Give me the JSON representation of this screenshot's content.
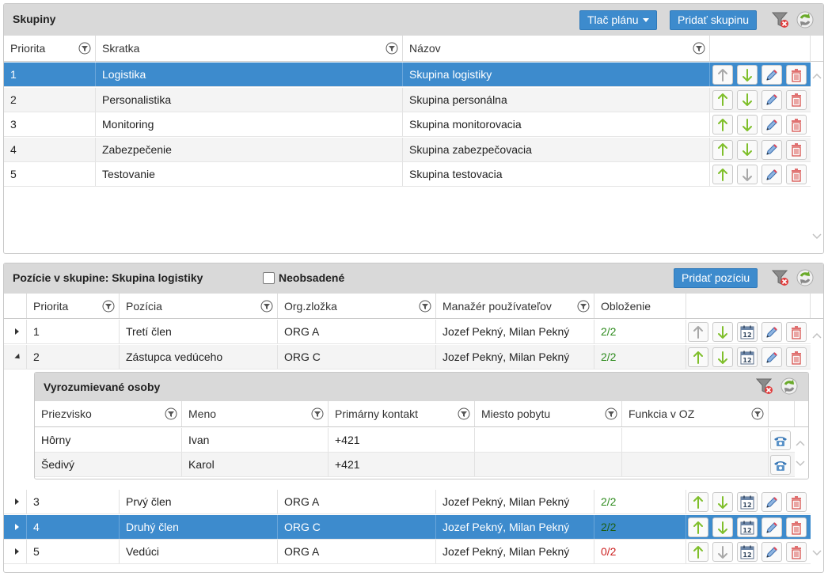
{
  "groups": {
    "title": "Skupiny",
    "print_button": "Tlač plánu",
    "add_button": "Pridať skupinu",
    "columns": [
      "Priorita",
      "Skratka",
      "Názov"
    ],
    "rows": [
      {
        "priority": "1",
        "abbr": "Logistika",
        "name": "Skupina logistiky"
      },
      {
        "priority": "2",
        "abbr": "Personalistika",
        "name": "Skupina personálna"
      },
      {
        "priority": "3",
        "abbr": "Monitoring",
        "name": "Skupina monitorovacia"
      },
      {
        "priority": "4",
        "abbr": "Zabezpečenie",
        "name": "Skupina zabezpečovacia"
      },
      {
        "priority": "5",
        "abbr": "Testovanie",
        "name": "Skupina testovacia"
      }
    ],
    "selected_row": 0
  },
  "positions": {
    "title": "Pozície v skupine: Skupina logistiky",
    "unfilled_label": "Neobsadené",
    "unfilled_checked": false,
    "add_button": "Pridať pozíciu",
    "columns": [
      "Priorita",
      "Pozícia",
      "Org.zložka",
      "Manažér používateľov",
      "Obloženie"
    ],
    "rows": [
      {
        "priority": "1",
        "position": "Tretí člen",
        "org": "ORG A",
        "manager": "Jozef Pekný, Milan Pekný",
        "occupancy": "2/2",
        "occupancy_status": "full",
        "expanded": false
      },
      {
        "priority": "2",
        "position": "Zástupca vedúceho",
        "org": "ORG C",
        "manager": "Jozef Pekný, Milan Pekný",
        "occupancy": "2/2",
        "occupancy_status": "full",
        "expanded": true
      },
      {
        "priority": "3",
        "position": "Prvý člen",
        "org": "ORG A",
        "manager": "Jozef Pekný, Milan Pekný",
        "occupancy": "2/2",
        "occupancy_status": "full",
        "expanded": false
      },
      {
        "priority": "4",
        "position": "Druhý člen",
        "org": "ORG C",
        "manager": "Jozef Pekný, Milan Pekný",
        "occupancy": "2/2",
        "occupancy_status": "full",
        "expanded": false
      },
      {
        "priority": "5",
        "position": "Vedúci",
        "org": "ORG A",
        "manager": "Jozef Pekný, Milan Pekný",
        "occupancy": "0/2",
        "occupancy_status": "empty",
        "expanded": false
      }
    ],
    "selected_row": 3
  },
  "notified": {
    "title": "Vyrozumievané osoby",
    "columns": [
      "Priezvisko",
      "Meno",
      "Primárny kontakt",
      "Miesto pobytu",
      "Funkcia v OZ"
    ],
    "rows": [
      {
        "surname": "Hôrny",
        "name": "Ivan",
        "contact": "+421",
        "residence": "",
        "function": ""
      },
      {
        "surname": "Šedivý",
        "name": "Karol",
        "contact": "+421",
        "residence": "",
        "function": ""
      }
    ]
  },
  "colors": {
    "accent": "#3d8bcd",
    "header_bg": "#d9d9d9",
    "arrow_green": "#7fbf2b",
    "arrow_disabled": "#a8a8a8",
    "delete_red": "#d9534f",
    "occupancy_full": "#2e8b1e",
    "occupancy_empty": "#cc1f1f"
  },
  "icons": {
    "move_up": "arrow-up-icon",
    "move_down": "arrow-down-icon",
    "edit": "pencil-icon",
    "delete": "trash-icon",
    "calendar": "calendar-icon",
    "phone": "phone-icon",
    "clear_filter": "clear-filter-icon",
    "refresh": "refresh-icon",
    "filter": "filter-icon"
  }
}
